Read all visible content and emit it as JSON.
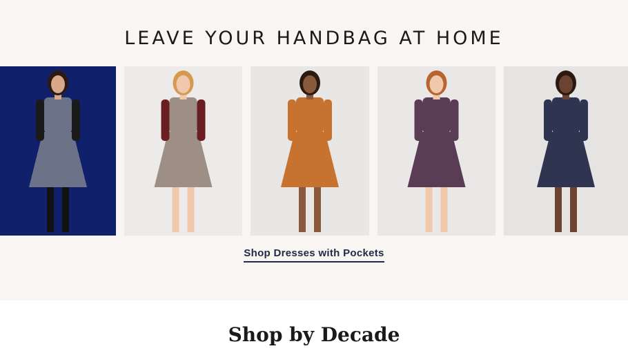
{
  "promo": {
    "heading": "LEAVE YOUR HANDBAG AT HOME",
    "link_label": "Shop Dresses with Pockets"
  },
  "products": [
    {
      "name": "grey-print-pinafore-dress",
      "bg": "#10206b",
      "dress": "#6c7288",
      "sleeve": "#1a1a1a",
      "skin": "#d9a88a",
      "hair": "#2a1a12"
    },
    {
      "name": "plaid-pinafore-dress",
      "bg": "#ecebea",
      "dress": "#9e8f86",
      "sleeve": "#6b1e22",
      "skin": "#f0c9ad",
      "hair": "#d49a52"
    },
    {
      "name": "fox-print-orange-dress",
      "bg": "#e8e7e6",
      "dress": "#c7732f",
      "sleeve": "#c7732f",
      "skin": "#8a5a3c",
      "hair": "#2a1a12"
    },
    {
      "name": "purple-print-dress",
      "bg": "#e9e8e7",
      "dress": "#5a3d55",
      "sleeve": "#5a3d55",
      "skin": "#f0c9ad",
      "hair": "#b8642e"
    },
    {
      "name": "navy-geometric-dress",
      "bg": "#e5e4e3",
      "dress": "#2f3550",
      "sleeve": "#2f3550",
      "skin": "#6b4330",
      "hair": "#2a1a12"
    }
  ],
  "decade": {
    "heading": "Shop by Decade"
  }
}
